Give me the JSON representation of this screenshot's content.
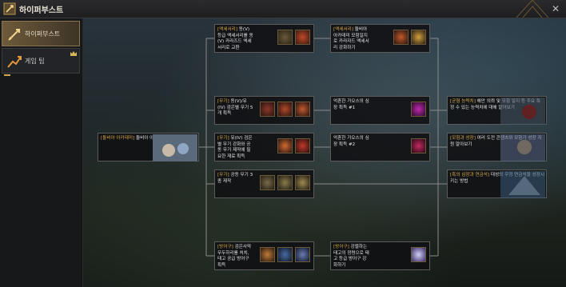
{
  "window": {
    "title": "하이퍼부스트",
    "close_icon": "close-icon"
  },
  "sidebar": {
    "items": [
      {
        "label": "하이퍼부스트",
        "icon": "sword-icon",
        "active": true
      },
      {
        "label": "게임 팁",
        "icon": "graph-up-icon",
        "active": false,
        "crown_icon": "crown-icon"
      }
    ]
  },
  "nodes": {
    "start": {
      "tag": "[돌비아 아카데미]",
      "text": "돌비아 아카데미"
    },
    "accessory_exchange": {
      "tag": "[액세서리]",
      "text": "동(V) 등급 액세서리를 동(V) 카라즈드 액세서리로 교환"
    },
    "accessory_enhance": {
      "tag": "[액세서리]",
      "text": "돌비아 아카데미 모험일지로 카라자드 액세서리 강화하기"
    },
    "weapon_acquire": {
      "tag": "[무기]",
      "text": "동(V)/유(IV) 검은별 무기 5개 획득"
    },
    "weapon_heart1": {
      "tag": "",
      "text": "억혼한 가오스의 심장 획득 #1"
    },
    "weapon_material": {
      "tag": "[무기]",
      "text": "유(IV) 검은별 무기 강화와 공동 무기 제작에 필요한 재료 획득"
    },
    "weapon_heart2": {
      "tag": "",
      "text": "억혼한 가오스의 심장 획득 #2"
    },
    "weapon_craft": {
      "tag": "[무기]",
      "text": "공동 무기 3종 제작"
    },
    "armor_acquire": {
      "tag": "[방어구]",
      "text": "검은사막 무두하리를 처치, 태고 공급 방어구 획득"
    },
    "armor_enhance": {
      "tag": "[방어구]",
      "text": "강렬하는 태고의 정령으로 태고 등급 방어구 강화하기"
    },
    "balance": {
      "tag": "[균형 능력치]",
      "text": "해안 의뢰 및 모험 일지 등 주요 특정 수 있는 능력치에 대해 알아보기"
    },
    "adventure_growth": {
      "tag": "[모험과 성장]",
      "text": "여러 도전 콘텐츠와 모험가 성장 지원 알아보기"
    },
    "black_spirit": {
      "tag": "[흑의 심장과 연금석]",
      "text": "대성의 우정 연금석을 성장시키는 방법"
    }
  },
  "colors": {
    "tag": "#d8a94a",
    "line": "#8a8a8a",
    "active_bg": "#6e5a3a"
  }
}
